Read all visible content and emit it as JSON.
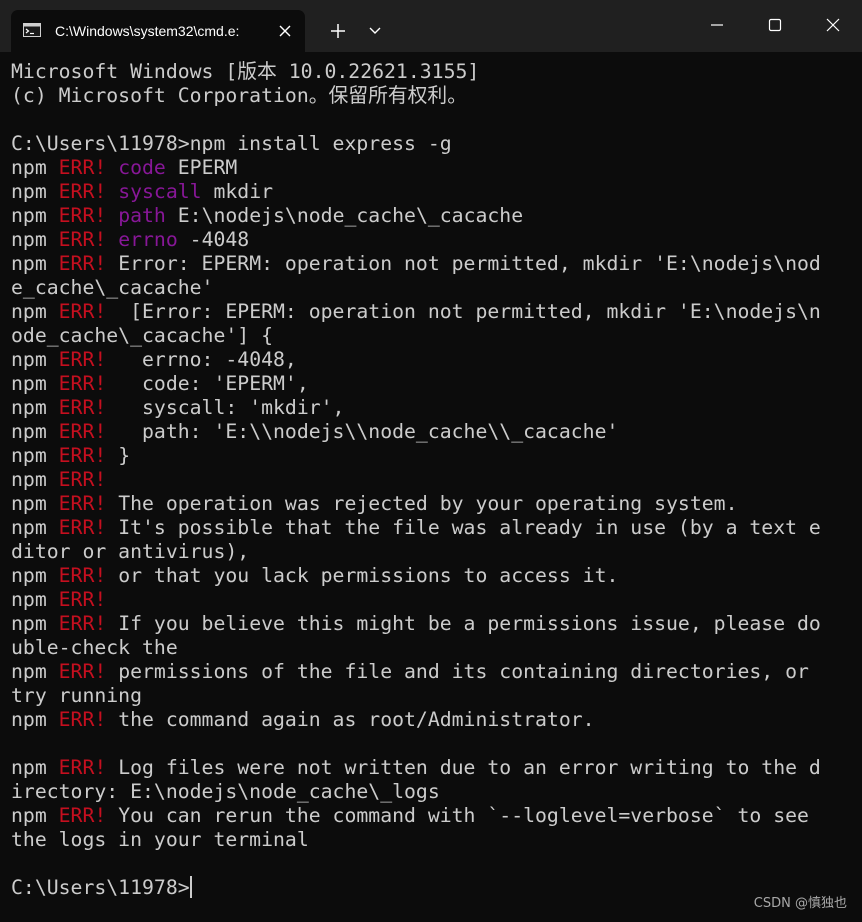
{
  "tab": {
    "title": "C:\\Windows\\system32\\cmd.e:",
    "icon": "cmd-terminal-icon"
  },
  "titlebar_buttons": {
    "new_tab_icon": "plus-icon",
    "dropdown_icon": "chevron-down-icon",
    "minimize_icon": "minimize-icon",
    "maximize_icon": "maximize-icon",
    "close_icon": "close-icon"
  },
  "colors": {
    "background": "#0c0c0c",
    "titlebar": "#202020",
    "text": "#cccccc",
    "err": "#c50f1f",
    "keyword": "#881798"
  },
  "terminal": {
    "lines": [
      [
        {
          "t": "Microsoft Windows [版本 10.0.22621.3155]"
        }
      ],
      [
        {
          "t": "(c) Microsoft Corporation。保留所有权利。"
        }
      ],
      [
        {
          "t": ""
        }
      ],
      [
        {
          "t": "C:\\Users\\11978>npm install express -g"
        }
      ],
      [
        {
          "t": "npm "
        },
        {
          "t": "ERR!",
          "c": "err"
        },
        {
          "t": " "
        },
        {
          "t": "code",
          "c": "key"
        },
        {
          "t": " EPERM"
        }
      ],
      [
        {
          "t": "npm "
        },
        {
          "t": "ERR!",
          "c": "err"
        },
        {
          "t": " "
        },
        {
          "t": "syscall",
          "c": "key"
        },
        {
          "t": " mkdir"
        }
      ],
      [
        {
          "t": "npm "
        },
        {
          "t": "ERR!",
          "c": "err"
        },
        {
          "t": " "
        },
        {
          "t": "path",
          "c": "key"
        },
        {
          "t": " E:\\nodejs\\node_cache\\_cacache"
        }
      ],
      [
        {
          "t": "npm "
        },
        {
          "t": "ERR!",
          "c": "err"
        },
        {
          "t": " "
        },
        {
          "t": "errno",
          "c": "key"
        },
        {
          "t": " -4048"
        }
      ],
      [
        {
          "t": "npm "
        },
        {
          "t": "ERR!",
          "c": "err"
        },
        {
          "t": " Error: EPERM: operation not permitted, mkdir 'E:\\nodejs\\nod"
        }
      ],
      [
        {
          "t": "e_cache\\_cacache'"
        }
      ],
      [
        {
          "t": "npm "
        },
        {
          "t": "ERR!",
          "c": "err"
        },
        {
          "t": "  [Error: EPERM: operation not permitted, mkdir 'E:\\nodejs\\n"
        }
      ],
      [
        {
          "t": "ode_cache\\_cacache'] {"
        }
      ],
      [
        {
          "t": "npm "
        },
        {
          "t": "ERR!",
          "c": "err"
        },
        {
          "t": "   errno: -4048,"
        }
      ],
      [
        {
          "t": "npm "
        },
        {
          "t": "ERR!",
          "c": "err"
        },
        {
          "t": "   code: 'EPERM',"
        }
      ],
      [
        {
          "t": "npm "
        },
        {
          "t": "ERR!",
          "c": "err"
        },
        {
          "t": "   syscall: 'mkdir',"
        }
      ],
      [
        {
          "t": "npm "
        },
        {
          "t": "ERR!",
          "c": "err"
        },
        {
          "t": "   path: 'E:\\\\nodejs\\\\node_cache\\\\_cacache'"
        }
      ],
      [
        {
          "t": "npm "
        },
        {
          "t": "ERR!",
          "c": "err"
        },
        {
          "t": " }"
        }
      ],
      [
        {
          "t": "npm "
        },
        {
          "t": "ERR!",
          "c": "err"
        }
      ],
      [
        {
          "t": "npm "
        },
        {
          "t": "ERR!",
          "c": "err"
        },
        {
          "t": " The operation was rejected by your operating system."
        }
      ],
      [
        {
          "t": "npm "
        },
        {
          "t": "ERR!",
          "c": "err"
        },
        {
          "t": " It's possible that the file was already in use (by a text e"
        }
      ],
      [
        {
          "t": "ditor or antivirus),"
        }
      ],
      [
        {
          "t": "npm "
        },
        {
          "t": "ERR!",
          "c": "err"
        },
        {
          "t": " or that you lack permissions to access it."
        }
      ],
      [
        {
          "t": "npm "
        },
        {
          "t": "ERR!",
          "c": "err"
        }
      ],
      [
        {
          "t": "npm "
        },
        {
          "t": "ERR!",
          "c": "err"
        },
        {
          "t": " If you believe this might be a permissions issue, please do"
        }
      ],
      [
        {
          "t": "uble-check the"
        }
      ],
      [
        {
          "t": "npm "
        },
        {
          "t": "ERR!",
          "c": "err"
        },
        {
          "t": " permissions of the file and its containing directories, or"
        }
      ],
      [
        {
          "t": "try running"
        }
      ],
      [
        {
          "t": "npm "
        },
        {
          "t": "ERR!",
          "c": "err"
        },
        {
          "t": " the command again as root/Administrator."
        }
      ],
      [
        {
          "t": ""
        }
      ],
      [
        {
          "t": "npm "
        },
        {
          "t": "ERR!",
          "c": "err"
        },
        {
          "t": " Log files were not written due to an error writing to the d"
        }
      ],
      [
        {
          "t": "irectory: E:\\nodejs\\node_cache\\_logs"
        }
      ],
      [
        {
          "t": "npm "
        },
        {
          "t": "ERR!",
          "c": "err"
        },
        {
          "t": " You can rerun the command with `--loglevel=verbose` to see"
        }
      ],
      [
        {
          "t": "the logs in your terminal"
        }
      ],
      [
        {
          "t": ""
        }
      ]
    ],
    "prompt": "C:\\Users\\11978>"
  },
  "watermark": "CSDN @慎独也"
}
